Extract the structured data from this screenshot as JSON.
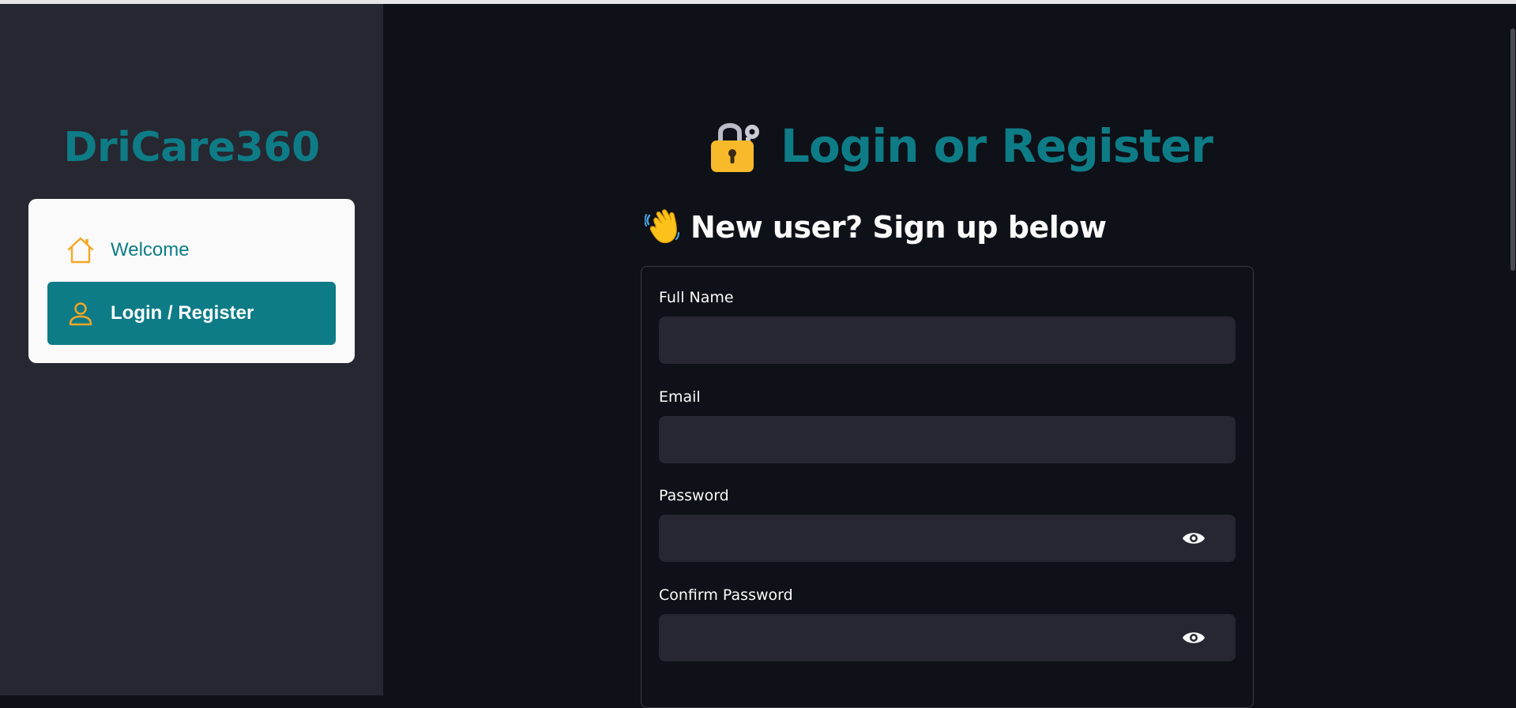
{
  "sidebar": {
    "brand": "DriCare360",
    "nav": [
      {
        "label": "Welcome",
        "icon": "house-icon",
        "active": false
      },
      {
        "label": "Login / Register",
        "icon": "person-icon",
        "active": true
      }
    ]
  },
  "main": {
    "title": "Login or Register",
    "title_icon": "locked-with-key-icon",
    "subtitle": "New user? Sign up below",
    "subtitle_icon": "waving-hand-icon",
    "form": {
      "full_name_label": "Full Name",
      "email_label": "Email",
      "password_label": "Password",
      "confirm_password_label": "Confirm Password",
      "full_name_value": "",
      "email_value": "",
      "password_value": "",
      "confirm_password_value": ""
    }
  },
  "colors": {
    "accent": "#0e7c86",
    "sidebar_bg": "#262730",
    "main_bg": "#0e1117",
    "icon_orange": "#f5a623"
  }
}
